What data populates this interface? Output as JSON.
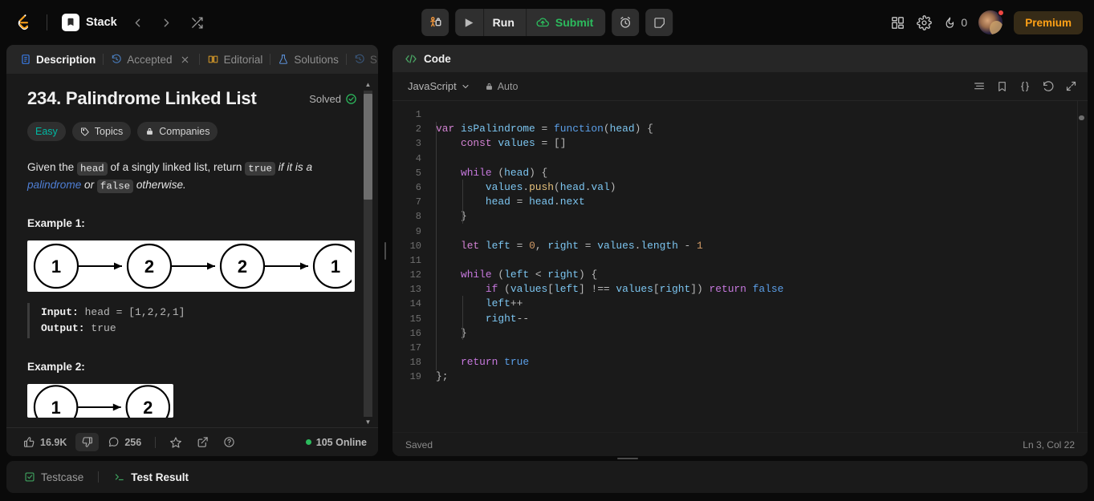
{
  "navbar": {
    "logo_icon": "leetcode-logo-icon",
    "stack": {
      "label": "Stack",
      "icon": "stack-book-icon"
    },
    "prev_icon": "chevron-left-icon",
    "next_icon": "chevron-right-icon",
    "shuffle_icon": "shuffle-icon",
    "playground_icon": "playground-debug-icon",
    "play_icon": "play-triangle-icon",
    "run_label": "Run",
    "submit_label": "Submit",
    "submit_icon": "cloud-upload-icon",
    "timer_icon": "alarm-clock-icon",
    "note_icon": "sticky-note-icon",
    "apps_icon": "grid-apps-icon",
    "settings_icon": "gear-icon",
    "streak_icon": "flame-icon",
    "streak_count": "0",
    "avatar_icon": "user-avatar",
    "premium_label": "Premium"
  },
  "left_panel": {
    "tabs": [
      {
        "label": "Description",
        "icon": "document-icon",
        "active": true,
        "closable": false
      },
      {
        "label": "Accepted",
        "icon": "history-icon",
        "active": false,
        "closable": true
      },
      {
        "label": "Editorial",
        "icon": "book-icon",
        "active": false,
        "closable": false
      },
      {
        "label": "Solutions",
        "icon": "flask-icon",
        "active": false,
        "closable": false
      },
      {
        "label": "S",
        "icon": "history-icon",
        "active": false,
        "closable": false
      }
    ],
    "problem": {
      "title": "234. Palindrome Linked List",
      "solved_label": "Solved",
      "solved_icon": "check-circle-icon",
      "difficulty": "Easy",
      "topics_label": "Topics",
      "topics_icon": "tag-icon",
      "companies_label": "Companies",
      "companies_icon": "lock-icon",
      "statement": {
        "p1_a": "Given the ",
        "code_head": "head",
        "p1_b": " of a singly linked list, return ",
        "code_true": "true",
        "p1_c": " if it is a ",
        "link_palindrome": "palindrome",
        "p1_d": " or ",
        "code_false": "false",
        "p1_e": " otherwise."
      },
      "examples": [
        {
          "heading": "Example 1:",
          "nodes": [
            "1",
            "2",
            "2",
            "1"
          ],
          "input_key": "Input:",
          "input_val": "head = [1,2,2,1]",
          "output_key": "Output:",
          "output_val": "true"
        },
        {
          "heading": "Example 2:",
          "nodes": [
            "1",
            "2"
          ]
        }
      ]
    },
    "footer": {
      "like_icon": "thumbs-up-icon",
      "like_count": "16.9K",
      "dislike_icon": "thumbs-down-icon",
      "comment_icon": "comment-icon",
      "comment_count": "256",
      "star_icon": "star-icon",
      "share_icon": "share-external-icon",
      "help_icon": "question-circle-icon",
      "online_label": "105 Online"
    },
    "scrollbar": {
      "up_icon": "scroll-up-arrow",
      "down_icon": "scroll-down-arrow"
    }
  },
  "code_panel": {
    "header_label": "Code",
    "header_icon": "code-brackets-icon",
    "language": "JavaScript",
    "language_caret_icon": "chevron-down-icon",
    "auto_label": "Auto",
    "auto_icon": "lock-icon",
    "tools": [
      {
        "icon": "format-lines-icon"
      },
      {
        "icon": "bookmark-icon"
      },
      {
        "icon": "curly-braces-icon"
      },
      {
        "icon": "reset-undo-icon"
      },
      {
        "icon": "expand-fullscreen-icon"
      }
    ],
    "status_left": "Saved",
    "status_right": "Ln 3, Col 22",
    "code_lines": [
      {
        "n": "1",
        "tokens": []
      },
      {
        "n": "2",
        "tokens": [
          {
            "t": "var ",
            "c": "kw"
          },
          {
            "t": "isPalindrome",
            "c": "ident"
          },
          {
            "t": " = ",
            "c": "punc"
          },
          {
            "t": "function",
            "c": "fn-kw"
          },
          {
            "t": "(",
            "c": "punc"
          },
          {
            "t": "head",
            "c": "ident"
          },
          {
            "t": ") {",
            "c": "punc"
          }
        ]
      },
      {
        "n": "3",
        "tokens": [
          {
            "t": "    ",
            "c": "plain"
          },
          {
            "t": "const ",
            "c": "kw"
          },
          {
            "t": "values",
            "c": "ident"
          },
          {
            "t": " = []",
            "c": "punc"
          }
        ]
      },
      {
        "n": "4",
        "tokens": []
      },
      {
        "n": "5",
        "tokens": [
          {
            "t": "    ",
            "c": "plain"
          },
          {
            "t": "while ",
            "c": "kw2"
          },
          {
            "t": "(",
            "c": "punc"
          },
          {
            "t": "head",
            "c": "ident"
          },
          {
            "t": ") {",
            "c": "punc"
          }
        ]
      },
      {
        "n": "6",
        "tokens": [
          {
            "t": "        ",
            "c": "plain"
          },
          {
            "t": "values",
            "c": "ident"
          },
          {
            "t": ".",
            "c": "punc"
          },
          {
            "t": "push",
            "c": "meth"
          },
          {
            "t": "(",
            "c": "punc"
          },
          {
            "t": "head",
            "c": "ident"
          },
          {
            "t": ".",
            "c": "punc"
          },
          {
            "t": "val",
            "c": "ident"
          },
          {
            "t": ")",
            "c": "punc"
          }
        ]
      },
      {
        "n": "7",
        "tokens": [
          {
            "t": "        ",
            "c": "plain"
          },
          {
            "t": "head",
            "c": "ident"
          },
          {
            "t": " = ",
            "c": "punc"
          },
          {
            "t": "head",
            "c": "ident"
          },
          {
            "t": ".",
            "c": "punc"
          },
          {
            "t": "next",
            "c": "ident"
          }
        ]
      },
      {
        "n": "8",
        "tokens": [
          {
            "t": "    }",
            "c": "punc"
          }
        ]
      },
      {
        "n": "9",
        "tokens": []
      },
      {
        "n": "10",
        "tokens": [
          {
            "t": "    ",
            "c": "plain"
          },
          {
            "t": "let ",
            "c": "kw"
          },
          {
            "t": "left",
            "c": "ident"
          },
          {
            "t": " = ",
            "c": "punc"
          },
          {
            "t": "0",
            "c": "num"
          },
          {
            "t": ", ",
            "c": "punc"
          },
          {
            "t": "right",
            "c": "ident"
          },
          {
            "t": " = ",
            "c": "punc"
          },
          {
            "t": "values",
            "c": "ident"
          },
          {
            "t": ".",
            "c": "punc"
          },
          {
            "t": "length",
            "c": "ident"
          },
          {
            "t": " - ",
            "c": "punc"
          },
          {
            "t": "1",
            "c": "num"
          }
        ]
      },
      {
        "n": "11",
        "tokens": []
      },
      {
        "n": "12",
        "tokens": [
          {
            "t": "    ",
            "c": "plain"
          },
          {
            "t": "while ",
            "c": "kw2"
          },
          {
            "t": "(",
            "c": "punc"
          },
          {
            "t": "left",
            "c": "ident"
          },
          {
            "t": " < ",
            "c": "punc"
          },
          {
            "t": "right",
            "c": "ident"
          },
          {
            "t": ") {",
            "c": "punc"
          }
        ]
      },
      {
        "n": "13",
        "tokens": [
          {
            "t": "        ",
            "c": "plain"
          },
          {
            "t": "if ",
            "c": "kw2"
          },
          {
            "t": "(",
            "c": "punc"
          },
          {
            "t": "values",
            "c": "ident"
          },
          {
            "t": "[",
            "c": "punc"
          },
          {
            "t": "left",
            "c": "ident"
          },
          {
            "t": "] !== ",
            "c": "punc"
          },
          {
            "t": "values",
            "c": "ident"
          },
          {
            "t": "[",
            "c": "punc"
          },
          {
            "t": "right",
            "c": "ident"
          },
          {
            "t": "]) ",
            "c": "punc"
          },
          {
            "t": "return ",
            "c": "kw2"
          },
          {
            "t": "false",
            "c": "bool"
          }
        ]
      },
      {
        "n": "14",
        "tokens": [
          {
            "t": "        ",
            "c": "plain"
          },
          {
            "t": "left",
            "c": "ident"
          },
          {
            "t": "++",
            "c": "punc"
          }
        ]
      },
      {
        "n": "15",
        "tokens": [
          {
            "t": "        ",
            "c": "plain"
          },
          {
            "t": "right",
            "c": "ident"
          },
          {
            "t": "--",
            "c": "punc"
          }
        ]
      },
      {
        "n": "16",
        "tokens": [
          {
            "t": "    }",
            "c": "punc"
          }
        ]
      },
      {
        "n": "17",
        "tokens": []
      },
      {
        "n": "18",
        "tokens": [
          {
            "t": "    ",
            "c": "plain"
          },
          {
            "t": "return ",
            "c": "kw2"
          },
          {
            "t": "true",
            "c": "bool"
          }
        ]
      },
      {
        "n": "19",
        "tokens": [
          {
            "t": "};",
            "c": "punc"
          }
        ]
      }
    ]
  },
  "console": {
    "tabs": [
      {
        "label": "Testcase",
        "icon": "checkbox-icon",
        "active": false
      },
      {
        "label": "Test Result",
        "icon": "terminal-prompt-icon",
        "active": true
      }
    ]
  },
  "colors": {
    "accent_orange": "#ffa116",
    "green": "#2cbb5d",
    "teal_easy": "#00b8a3",
    "link_blue": "#4f7fd6",
    "notif_red": "#ef4743"
  }
}
